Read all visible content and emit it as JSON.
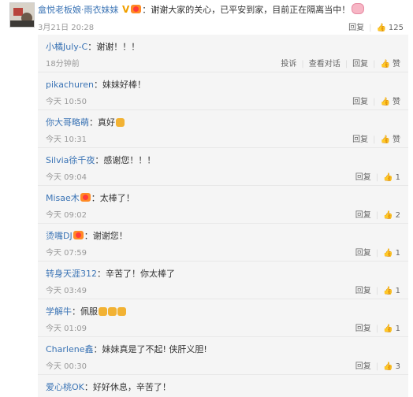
{
  "main": {
    "username": "盒悦老板娘·雨衣妹妹",
    "text": "谢谢大家的关心，已平安到家，目前正在隔离当中！",
    "time": "3月21日 20:28",
    "reply_label": "回复",
    "like_count": "125",
    "v_glyph": "V"
  },
  "actions": {
    "report": "投诉",
    "view_conversation": "查看对话",
    "reply": "回复",
    "like": "赞"
  },
  "colon": "：",
  "replies": [
    {
      "user": "小橘July-C",
      "text": "谢谢！！！",
      "time": "18分钟前",
      "likes": "赞",
      "fan_badge": false,
      "emoji": "",
      "extra_actions": true
    },
    {
      "user": "pikachuren",
      "text": "妹妹好棒！",
      "time": "今天 10:50",
      "likes": "赞",
      "fan_badge": false,
      "emoji": "",
      "extra_actions": false
    },
    {
      "user": "你大哥略萌",
      "text": "真好",
      "time": "今天 10:31",
      "likes": "赞",
      "fan_badge": false,
      "emoji": "thumb",
      "extra_actions": false
    },
    {
      "user": "Silvia徐千夜",
      "text": "感谢您！！！",
      "time": "今天 09:04",
      "likes": "1",
      "fan_badge": false,
      "emoji": "",
      "extra_actions": false
    },
    {
      "user": "Misae木",
      "text": "太棒了！",
      "time": "今天 09:02",
      "likes": "2",
      "fan_badge": true,
      "emoji": "",
      "extra_actions": false
    },
    {
      "user": "烫嘴DJ",
      "text": "谢谢您！",
      "time": "今天 07:59",
      "likes": "1",
      "fan_badge": true,
      "emoji": "",
      "extra_actions": false
    },
    {
      "user": "转身天涯312",
      "text": "辛苦了！你太棒了",
      "time": "今天 03:49",
      "likes": "1",
      "fan_badge": false,
      "emoji": "",
      "extra_actions": false
    },
    {
      "user": "学解牛",
      "text": "佩服",
      "time": "今天 01:09",
      "likes": "1",
      "fan_badge": false,
      "emoji": "thumb3",
      "extra_actions": false
    },
    {
      "user": "Charlene鑫",
      "text": "妹妹真是了不起! 侠肝义胆!",
      "time": "今天 00:30",
      "likes": "3",
      "fan_badge": false,
      "emoji": "",
      "extra_actions": false
    },
    {
      "user": "爱心桃OK",
      "text": "好好休息，辛苦了！",
      "time": "",
      "likes": "",
      "fan_badge": false,
      "emoji": "",
      "extra_actions": false
    }
  ],
  "colors": {
    "username": "#3b74b5",
    "meta": "#999999",
    "reply_bg": "#f5f5f5",
    "v_badge": "#f0a000"
  }
}
